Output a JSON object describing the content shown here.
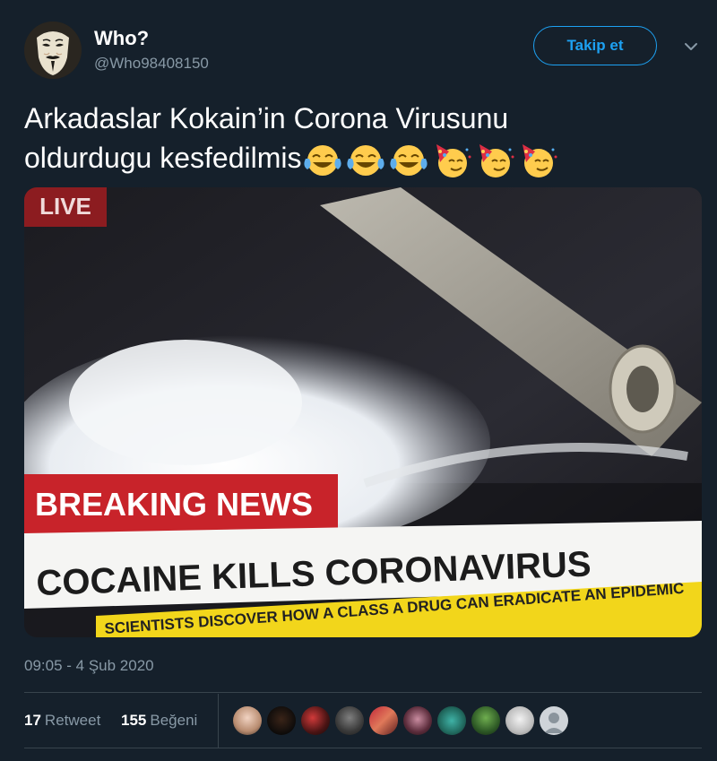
{
  "user": {
    "name": "Who?",
    "handle": "@Who98408150",
    "follow_label": "Takip et"
  },
  "tweet": {
    "text_line1": "Arkadaslar Kokain’in Corona Virusunu",
    "text_line2": "oldurdugu kesfedilmis",
    "emojis": [
      "face-with-tears-of-joy",
      "face-with-tears-of-joy",
      "face-with-tears-of-joy",
      "partying-face",
      "partying-face",
      "partying-face"
    ]
  },
  "media": {
    "live_label": "LIVE",
    "breaking_label": "BREAKING NEWS",
    "headline": "COCAINE KILLS CORONAVIRUS",
    "ticker": "SCIENTISTS DISCOVER HOW A CLASS A DRUG CAN ERADICATE AN EPIDEMIC"
  },
  "timestamp": "09:05 - 4 Şub 2020",
  "stats": {
    "retweets_count": "17",
    "retweets_label": "Retweet",
    "likes_count": "155",
    "likes_label": "Beğeni"
  },
  "colors": {
    "background": "#15202b",
    "accent": "#1da1f2",
    "secondary_text": "#8899a6",
    "divider": "#38444d",
    "breaking_red": "#c8232a",
    "ticker_yellow": "#f2d61b"
  }
}
